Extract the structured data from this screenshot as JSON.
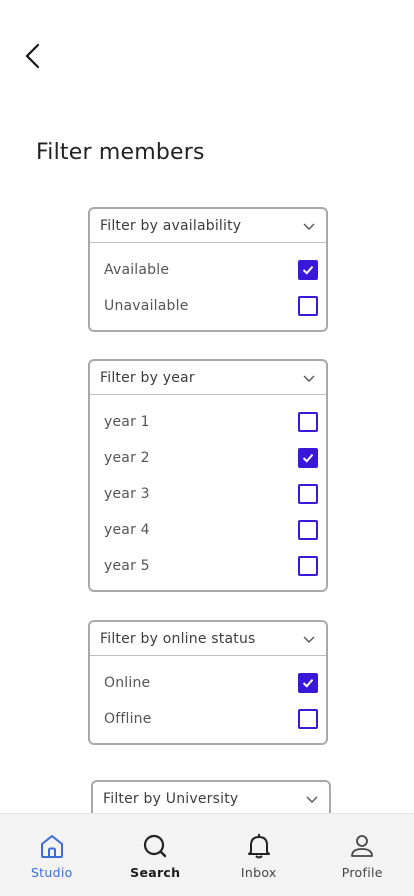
{
  "title": "Filter members",
  "filters": [
    {
      "label": "Filter by availability",
      "options": [
        {
          "label": "Available",
          "checked": true
        },
        {
          "label": "Unavailable",
          "checked": false
        }
      ]
    },
    {
      "label": "Filter by year",
      "options": [
        {
          "label": "year 1",
          "checked": false
        },
        {
          "label": "year 2",
          "checked": true
        },
        {
          "label": "year 3",
          "checked": false
        },
        {
          "label": "year 4",
          "checked": false
        },
        {
          "label": "year 5",
          "checked": false
        }
      ]
    },
    {
      "label": "Filter by online status",
      "options": [
        {
          "label": "Online",
          "checked": true
        },
        {
          "label": "Offline",
          "checked": false
        }
      ]
    },
    {
      "label": "Filter by University",
      "options": []
    }
  ],
  "tabs": [
    {
      "label": "Studio",
      "icon": "home-icon"
    },
    {
      "label": "Search",
      "icon": "search-icon"
    },
    {
      "label": "Inbox",
      "icon": "bell-icon"
    },
    {
      "label": "Profile",
      "icon": "user-icon"
    }
  ],
  "colors": {
    "accent": "#3a18d8",
    "active_tab": "#3b6dd8",
    "border": "#a9a9a9"
  }
}
